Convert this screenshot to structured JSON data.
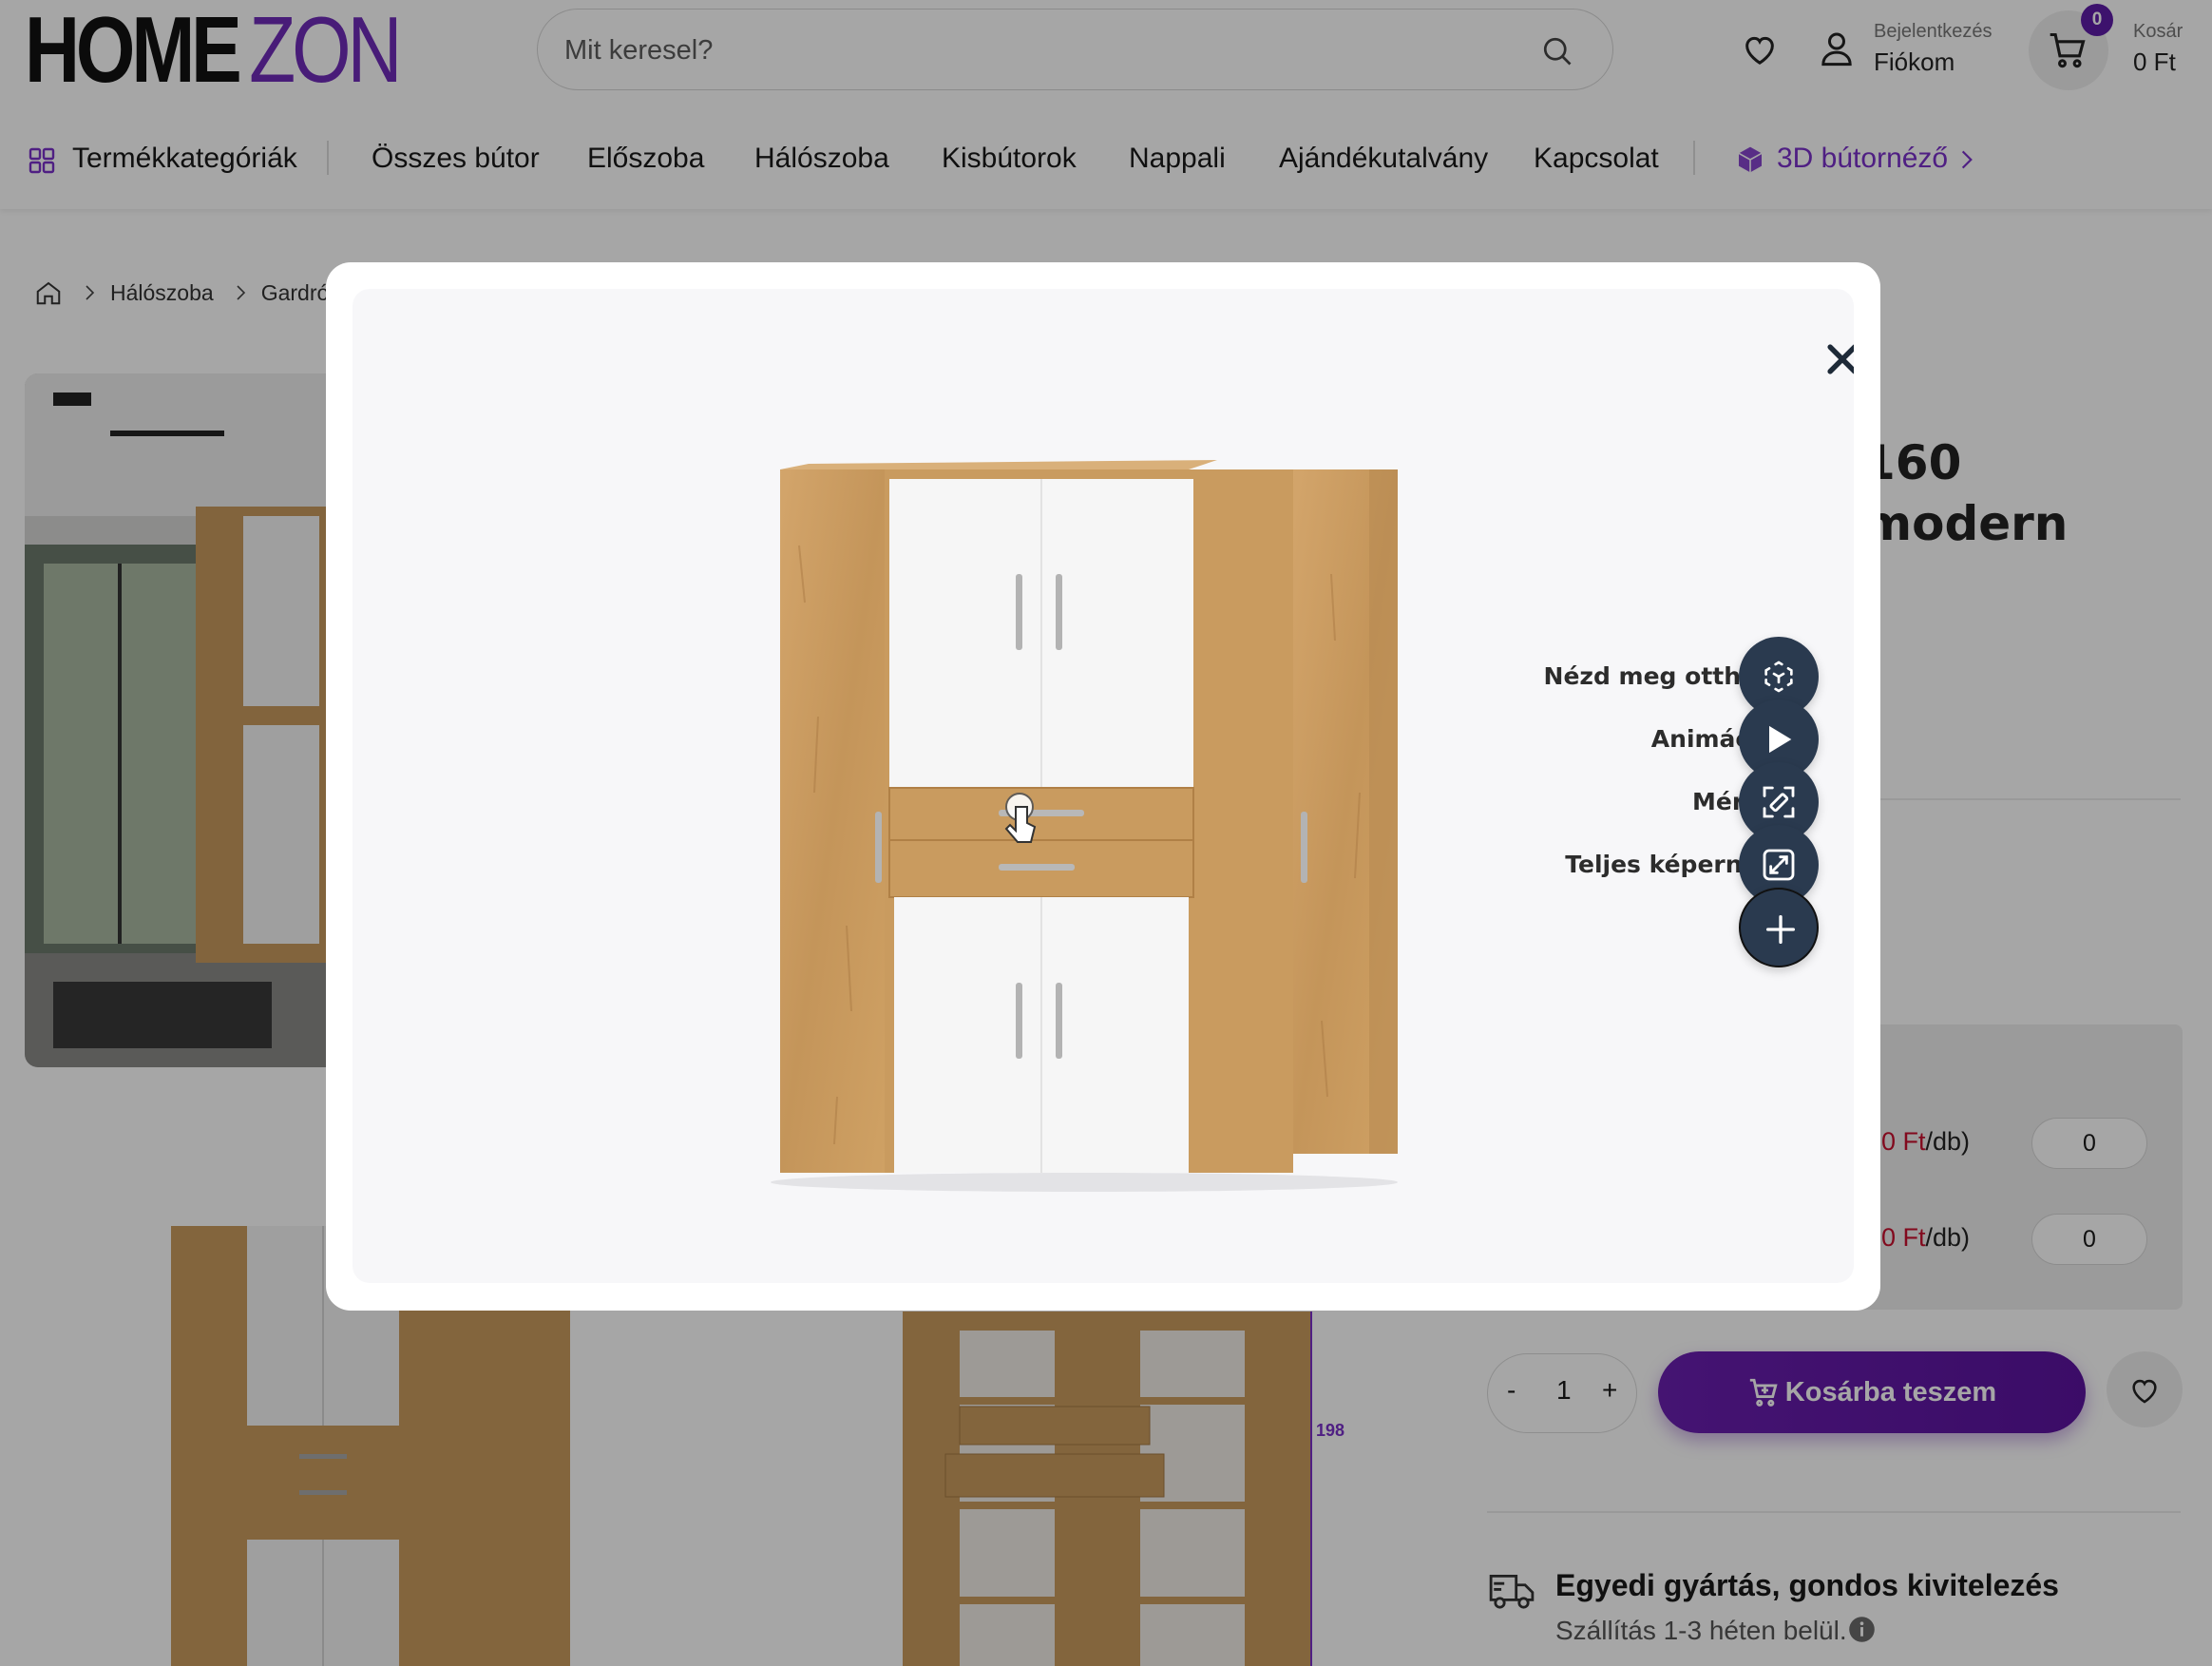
{
  "brand": {
    "part1": "HOME",
    "part2": "ZON",
    "accent": "#6f2bb8"
  },
  "search": {
    "placeholder": "Mit keresel?"
  },
  "account": {
    "small": "Bejelentkezés",
    "label": "Fiókom"
  },
  "cart": {
    "count": "0",
    "small": "Kosár",
    "amount": "0 Ft"
  },
  "nav": {
    "categories": "Termékkategóriák",
    "items": [
      "Összes bútor",
      "Előszoba",
      "Hálószoba",
      "Kisbútorok",
      "Nappali",
      "Ajándékutalvány",
      "Kapcsolat"
    ],
    "viewer3d": "3D bútornéző"
  },
  "breadcrumb": [
    "Hálószoba",
    "Gardróbo"
  ],
  "product": {
    "title_line1": "160",
    "title_line2": "modern",
    "dimension": "198",
    "price_rows": [
      {
        "red": "0 Ft",
        "suffix": "/db)",
        "qty": "0"
      },
      {
        "red": "0 Ft",
        "suffix": "/db)",
        "qty": "0"
      }
    ],
    "quantity": "1",
    "minus": "-",
    "plus": "+",
    "add_to_cart": "Kosárba teszem"
  },
  "shipping": {
    "title": "Egyedi gyártás, gondos kivitelezés",
    "subtitle": "Szállítás 1-3 héten belül."
  },
  "viewer": {
    "actions": [
      {
        "label": "Nézd meg otthon",
        "icon": "ar-cube-icon"
      },
      {
        "label": "Animáció",
        "icon": "play-icon"
      },
      {
        "label": "Mérés",
        "icon": "ruler-icon"
      },
      {
        "label": "Teljes képernyő",
        "icon": "fullscreen-icon"
      }
    ],
    "expand_icon": "plus-icon",
    "close_icon": "close-icon"
  }
}
